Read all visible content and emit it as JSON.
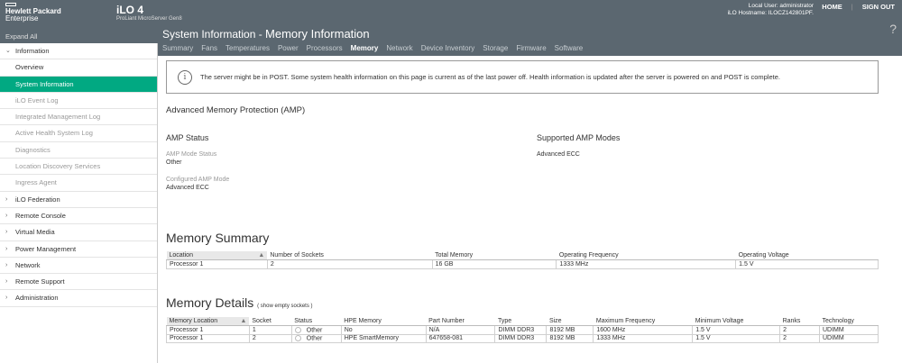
{
  "header": {
    "brand_line1": "Hewlett Packard",
    "brand_line2": "Enterprise",
    "product": "iLO 4",
    "server": "ProLiant MicroServer Gen8",
    "local_user": "Local User: administrator",
    "hostname": "iLO Hostname: ILOCZ142801PF.",
    "home": "HOME",
    "sign_out": "SIGN OUT",
    "help": "?",
    "expand_all": "Expand All"
  },
  "page": {
    "title_prefix": "System Information - ",
    "title_main": "Memory Information"
  },
  "tabs": [
    "Summary",
    "Fans",
    "Temperatures",
    "Power",
    "Processors",
    "Memory",
    "Network",
    "Device Inventory",
    "Storage",
    "Firmware",
    "Software"
  ],
  "sidebar": [
    {
      "label": "Information",
      "type": "group",
      "expanded": true
    },
    {
      "label": "Overview",
      "type": "item"
    },
    {
      "label": "System Information",
      "type": "item",
      "active": true
    },
    {
      "label": "iLO Event Log",
      "type": "sub"
    },
    {
      "label": "Integrated Management Log",
      "type": "sub"
    },
    {
      "label": "Active Health System Log",
      "type": "sub"
    },
    {
      "label": "Diagnostics",
      "type": "sub"
    },
    {
      "label": "Location Discovery Services",
      "type": "sub"
    },
    {
      "label": "Ingress Agent",
      "type": "sub"
    },
    {
      "label": "iLO Federation",
      "type": "group"
    },
    {
      "label": "Remote Console",
      "type": "group"
    },
    {
      "label": "Virtual Media",
      "type": "group"
    },
    {
      "label": "Power Management",
      "type": "group"
    },
    {
      "label": "Network",
      "type": "group"
    },
    {
      "label": "Remote Support",
      "type": "group"
    },
    {
      "label": "Administration",
      "type": "group"
    }
  ],
  "alert": "The server might be in POST. Some system health information on this page is current as of the last power off. Health information is updated after the server is powered on and POST is complete.",
  "amp": {
    "title": "Advanced Memory Protection (AMP)",
    "status_title": "AMP Status",
    "mode_status_label": "AMP Mode Status",
    "mode_status": "Other",
    "configured_label": "Configured AMP Mode",
    "configured": "Advanced ECC",
    "supported_title": "Supported AMP Modes",
    "supported": "Advanced ECC"
  },
  "summary": {
    "title": "Memory Summary",
    "headers": [
      "Location",
      "Number of Sockets",
      "Total Memory",
      "Operating Frequency",
      "Operating Voltage"
    ],
    "rows": [
      [
        "Processor 1",
        "2",
        "16 GB",
        "1333 MHz",
        "1.5 V"
      ]
    ]
  },
  "details": {
    "title": "Memory Details",
    "link": "( show empty sockets )",
    "headers": [
      "Memory Location",
      "Socket",
      "Status",
      "HPE Memory",
      "Part Number",
      "Type",
      "Size",
      "Maximum Frequency",
      "Minimum Voltage",
      "Ranks",
      "Technology"
    ],
    "rows": [
      [
        "Processor 1",
        "1",
        "Other",
        "No",
        "N/A",
        "DIMM DDR3",
        "8192 MB",
        "1600 MHz",
        "1.5 V",
        "2",
        "UDIMM"
      ],
      [
        "Processor 1",
        "2",
        "Other",
        "HPE SmartMemory",
        "647658-081",
        "DIMM DDR3",
        "8192 MB",
        "1333 MHz",
        "1.5 V",
        "2",
        "UDIMM"
      ]
    ]
  }
}
